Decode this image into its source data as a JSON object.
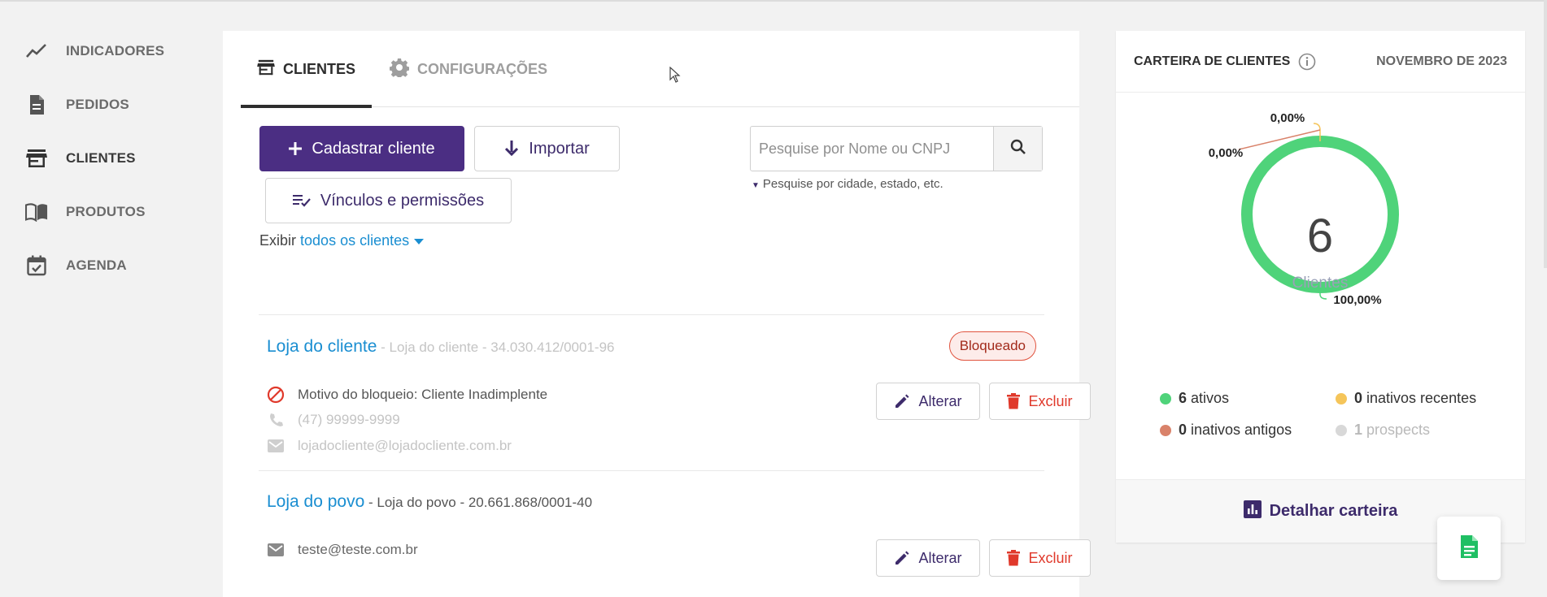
{
  "sidebar": {
    "items": [
      {
        "label": "INDICADORES",
        "icon": "trend-line-icon"
      },
      {
        "label": "PEDIDOS",
        "icon": "document-icon"
      },
      {
        "label": "CLIENTES",
        "icon": "store-icon"
      },
      {
        "label": "PRODUTOS",
        "icon": "book-icon"
      },
      {
        "label": "AGENDA",
        "icon": "calendar-check-icon"
      }
    ],
    "active": "CLIENTES"
  },
  "tabs": [
    {
      "label": "CLIENTES",
      "icon": "store-icon",
      "active": true
    },
    {
      "label": "CONFIGURAÇÕES",
      "icon": "gear-icon",
      "active": false
    }
  ],
  "toolbar": {
    "add_label": "Cadastrar cliente",
    "import_label": "Importar",
    "links_label": "Vínculos e permissões"
  },
  "search": {
    "placeholder": "Pesquise por Nome ou CNPJ",
    "hint": "Pesquise por cidade, estado, etc."
  },
  "filter": {
    "prefix": "Exibir",
    "value": "todos os clientes"
  },
  "clients": [
    {
      "name": "Loja do cliente",
      "subtitle": " - Loja do cliente - 34.030.412/0001-96",
      "badge": "Bloqueado",
      "block_reason": "Motivo do bloqueio: Cliente Inadimplente",
      "phone": "(47) 99999-9999",
      "email": "lojadocliente@lojadocliente.com.br",
      "edit_label": "Alterar",
      "delete_label": "Excluir"
    },
    {
      "name": "Loja do povo",
      "subtitle": " - Loja do povo - 20.661.868/0001-40",
      "email": "teste@teste.com.br",
      "edit_label": "Alterar",
      "delete_label": "Excluir"
    }
  ],
  "portfolio": {
    "title": "CARTEIRA DE CLIENTES",
    "month": "NOVEMBRO DE 2023",
    "total": "6",
    "total_label": "Clientes",
    "slice_labels": [
      "0,00%",
      "0,00%",
      "100,00%"
    ],
    "legend": [
      {
        "count": "6",
        "label": "ativos",
        "color": "#4fd37a"
      },
      {
        "count": "0",
        "label": "inativos recentes",
        "color": "#f5c55a"
      },
      {
        "count": "0",
        "label": "inativos antigos",
        "color": "#d9826a"
      },
      {
        "count": "1",
        "label": "prospects",
        "color": "#d8d8d8"
      }
    ],
    "detail_label": "Detalhar carteira"
  },
  "chart_data": {
    "type": "pie",
    "categories": [
      "ativos",
      "inativos recentes",
      "inativos antigos"
    ],
    "values": [
      100.0,
      0.0,
      0.0
    ],
    "colors": [
      "#4fd37a",
      "#f5c55a",
      "#d9826a"
    ]
  },
  "colors": {
    "primary": "#4b2e83",
    "link": "#1a8ed1",
    "danger": "#e0392b",
    "active_green": "#4fd37a"
  }
}
